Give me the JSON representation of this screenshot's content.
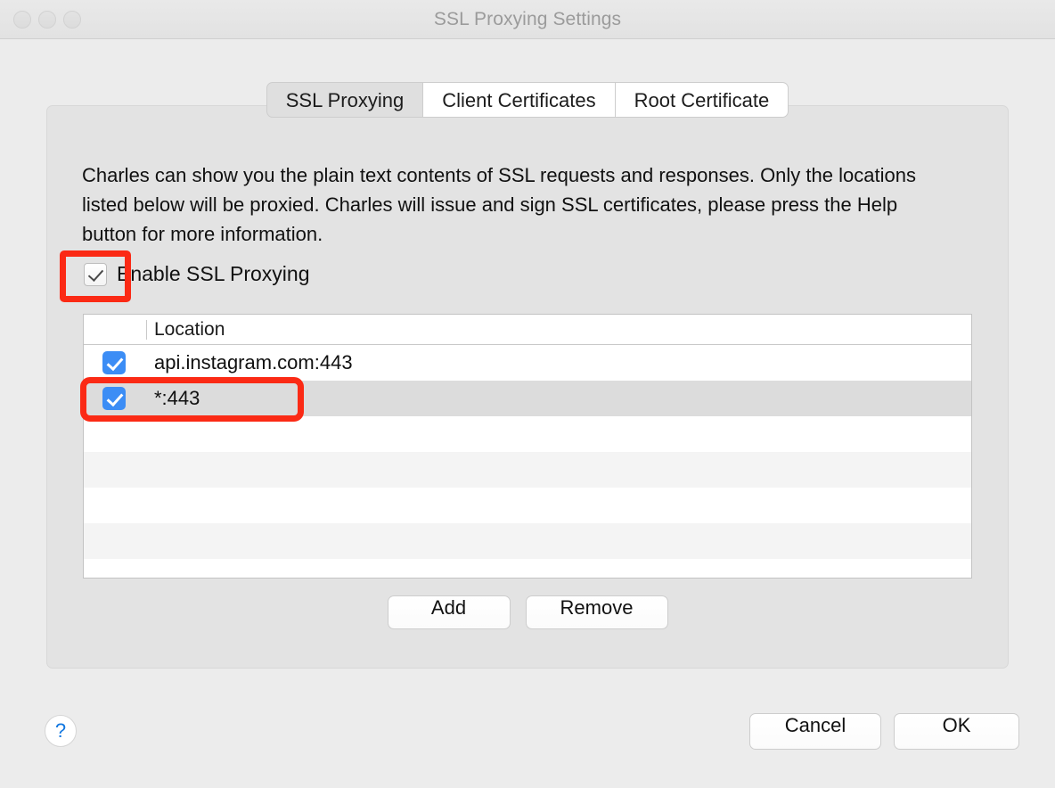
{
  "window": {
    "title": "SSL Proxying Settings",
    "traffic_lights": [
      "close-button",
      "minimize-button",
      "zoom-button"
    ]
  },
  "tabs": [
    {
      "label": "SSL Proxying",
      "active": true
    },
    {
      "label": "Client Certificates",
      "active": false
    },
    {
      "label": "Root Certificate",
      "active": false
    }
  ],
  "description": "Charles can show you the plain text contents of SSL requests and responses. Only the locations listed below will be proxied. Charles will issue and sign SSL certificates, please press the Help button for more information.",
  "enable_checkbox": {
    "label": "Enable SSL Proxying",
    "checked": true
  },
  "table": {
    "column_header": "Location",
    "rows": [
      {
        "label": "api.instagram.com:443",
        "checked": true,
        "selected": false
      },
      {
        "label": "*:443",
        "checked": true,
        "selected": true
      }
    ],
    "empty_row_count": 5
  },
  "list_buttons": {
    "add": "Add",
    "remove": "Remove"
  },
  "footer": {
    "help": "?",
    "cancel": "Cancel",
    "ok": "OK"
  },
  "annotations": {
    "color": "#fb2a15",
    "highlights": [
      "enable-ssl-proxying-checkbox",
      "wildcard-443-row"
    ]
  }
}
